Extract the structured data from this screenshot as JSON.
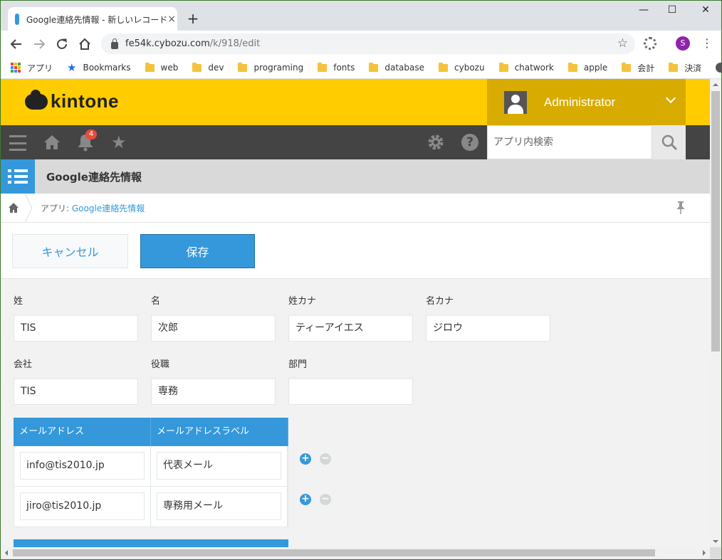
{
  "browser": {
    "tab_title": "Google連絡先情報 - 新しいレコード",
    "tab_close": "×",
    "new_tab": "+",
    "window_min": "—",
    "window_max": "☐",
    "window_close": "✕",
    "url_host": "fe54k.cybozu.com",
    "url_path": "/k/918/edit",
    "profile_initial": "S",
    "bookmarks": [
      "アプリ",
      "Bookmarks",
      "web",
      "dev",
      "programing",
      "fonts",
      "database",
      "cybozu",
      "chatwork",
      "apple",
      "会計",
      "決済"
    ]
  },
  "kintone": {
    "logo_text": "kintone",
    "user_name": "Administrator",
    "notification_count": "4",
    "search_placeholder": "アプリ内検索",
    "app_title": "Google連絡先情報",
    "breadcrumb_prefix": "アプリ:",
    "breadcrumb_link": "Google連絡先情報",
    "cancel_label": "キャンセル",
    "save_label": "保存",
    "accent_color": "#3498db",
    "header_color": "#ffcc00"
  },
  "form": {
    "fields": [
      {
        "label": "姓",
        "value": "TIS"
      },
      {
        "label": "名",
        "value": "次郎"
      },
      {
        "label": "姓カナ",
        "value": "ティーアイエス"
      },
      {
        "label": "名カナ",
        "value": "ジロウ"
      },
      {
        "label": "会社",
        "value": "TIS"
      },
      {
        "label": "役職",
        "value": "専務"
      },
      {
        "label": "部門",
        "value": ""
      }
    ],
    "subtable": {
      "headers": [
        "メールアドレス",
        "メールアドレスラベル"
      ],
      "rows": [
        {
          "email": "info@tis2010.jp",
          "label": "代表メール"
        },
        {
          "email": "jiro@tis2010.jp",
          "label": "専務用メール"
        }
      ],
      "add_symbol": "+",
      "remove_symbol": "−"
    }
  }
}
